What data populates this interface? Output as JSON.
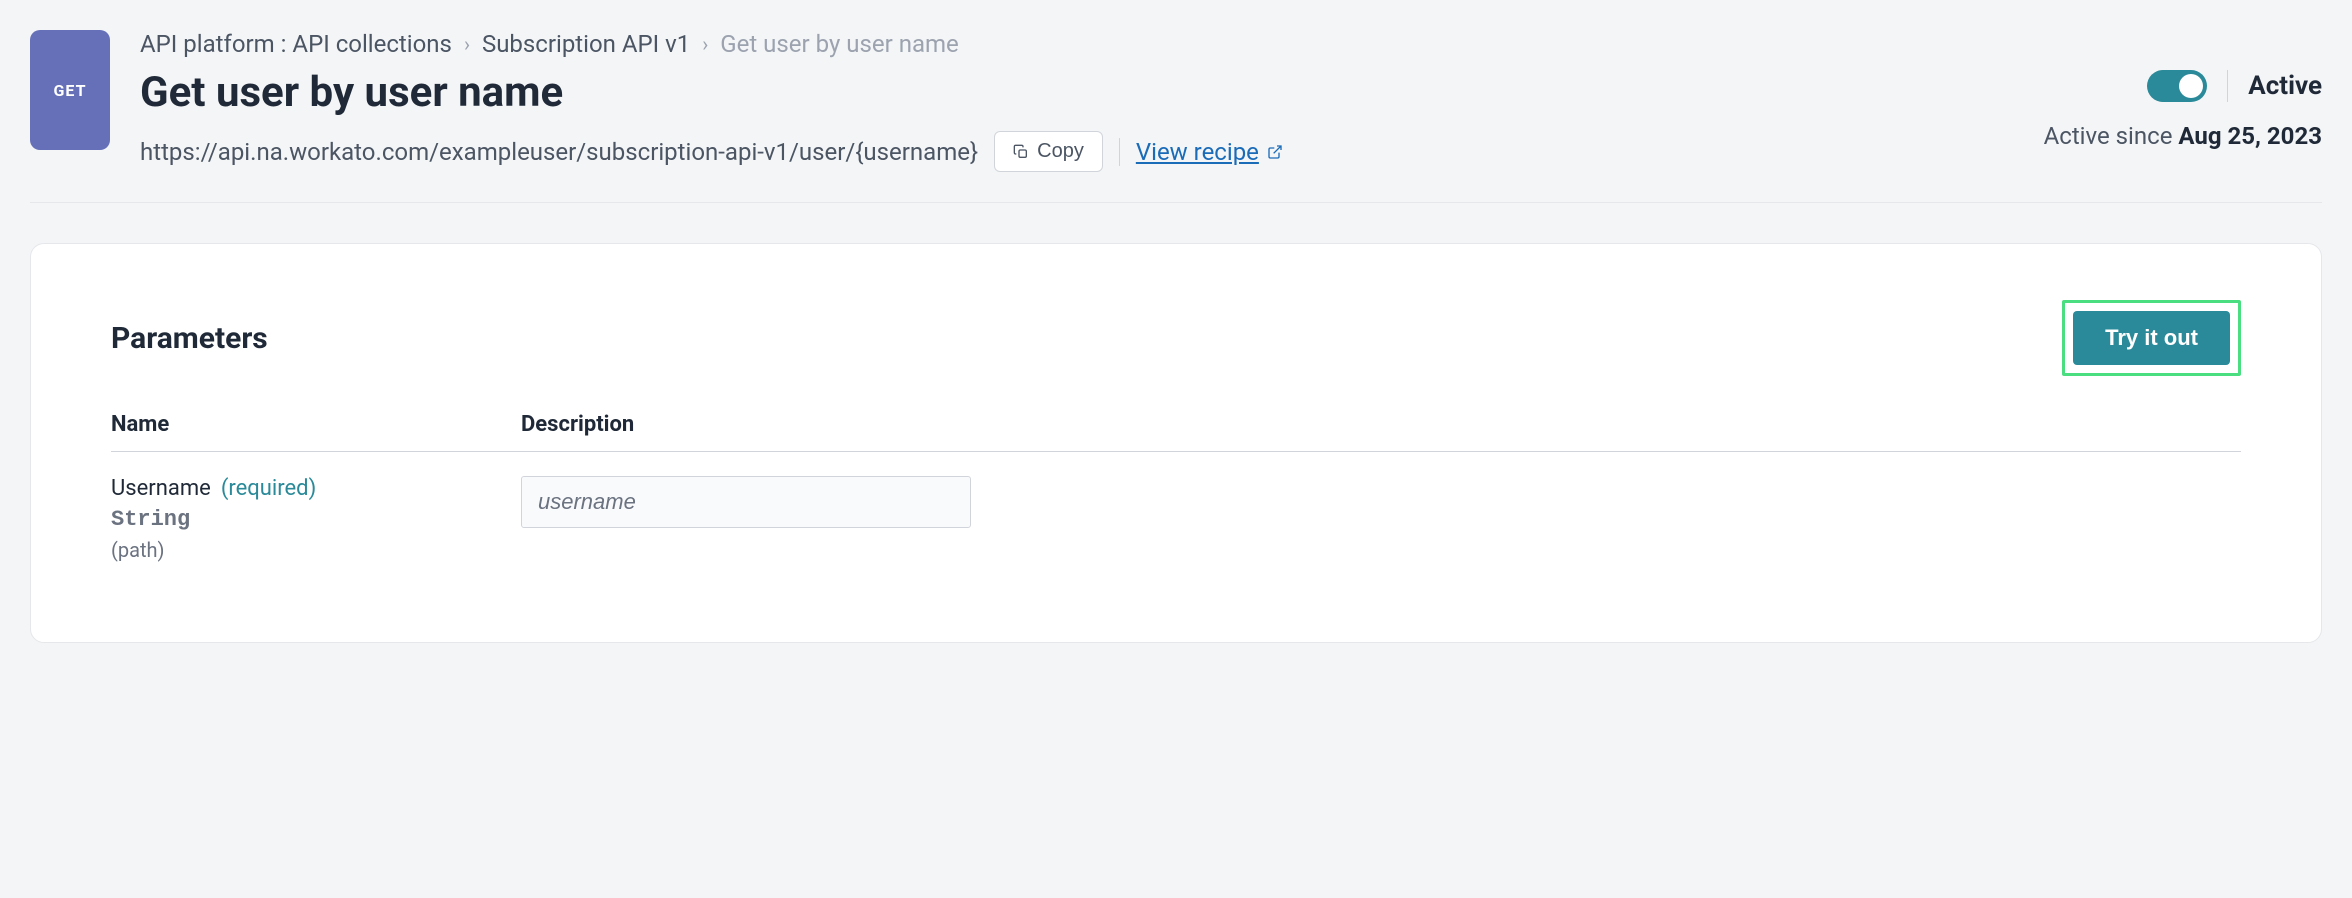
{
  "method": "GET",
  "breadcrumb": {
    "root": "API platform : API collections",
    "parent": "Subscription API v1",
    "current": "Get user by user name"
  },
  "title": "Get user by user name",
  "url": "https://api.na.workato.com/exampleuser/subscription-api-v1/user/{username}",
  "copy_label": "Copy",
  "view_recipe_label": "View recipe",
  "status": {
    "label": "Active",
    "since_prefix": "Active since ",
    "since_date": "Aug 25, 2023"
  },
  "panel": {
    "title": "Parameters",
    "try_label": "Try it out",
    "columns": {
      "name": "Name",
      "description": "Description"
    },
    "params": [
      {
        "name": "Username",
        "required_label": "(required)",
        "type": "String",
        "in": "(path)",
        "placeholder": "username"
      }
    ]
  }
}
